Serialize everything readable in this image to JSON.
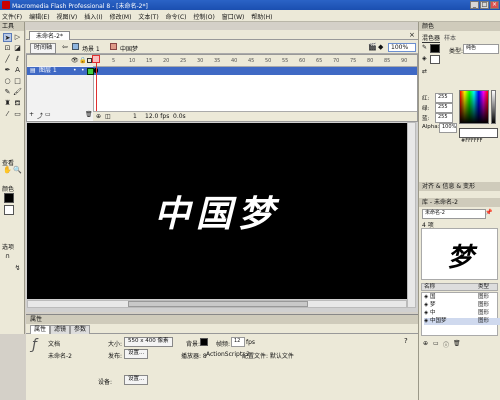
{
  "window": {
    "title": "Macromedia Flash Professional 8 - [未命名-2*]"
  },
  "menu": [
    "文件(F)",
    "编辑(E)",
    "视图(V)",
    "插入(I)",
    "修改(M)",
    "文本(T)",
    "命令(C)",
    "控制(O)",
    "窗口(W)",
    "帮助(H)"
  ],
  "toolbox": {
    "header": "工具",
    "sections": [
      "查看",
      "颜色",
      "选项"
    ]
  },
  "document": {
    "tab": "未命名-2*",
    "timeline_button": "时间轴",
    "scene_label": "场景 1",
    "symbol_label": "中国梦",
    "zoom": "100%"
  },
  "timeline": {
    "layer_name": "图层 1",
    "frame_numbers": [
      "1",
      "5",
      "10",
      "15",
      "20",
      "25",
      "30",
      "35",
      "40",
      "45",
      "50",
      "55",
      "60",
      "65",
      "70",
      "75",
      "80",
      "85",
      "90"
    ],
    "current_frame": "1",
    "fps": "12.0 fps",
    "time": "0.0s"
  },
  "stage": {
    "text": "中国梦"
  },
  "properties": {
    "panel_title": "属性",
    "tabs": [
      "属性",
      "滤镜",
      "参数"
    ],
    "doc_type": "文档",
    "doc_name": "未命名-2",
    "size_label": "大小:",
    "size_value": "550 x 400 像素",
    "bg_label": "背景:",
    "fps_label": "帧频:",
    "fps_value": "12",
    "fps_unit": "fps",
    "publish_label": "发布:",
    "settings_button": "设置...",
    "player_label": "播放器: 8",
    "as_label": "ActionScript: 2",
    "profile_label": "配置文件: 默认文件",
    "device_label": "设备:",
    "device_button": "设置..."
  },
  "color_panel": {
    "title": "颜色",
    "tabs": [
      "混色器",
      "样本"
    ],
    "type_label": "类型:",
    "type_value": "纯色",
    "r": "255",
    "g": "255",
    "b": "255",
    "alpha_label": "Alpha:",
    "alpha_value": "100%",
    "hex": "#FFFFFF",
    "colors": {
      "fill": "#FFFFFF",
      "stroke": "#000000"
    }
  },
  "align_panel": {
    "title": "对齐 & 信息 & 变形"
  },
  "library": {
    "title": "库 - 未命名-2",
    "doc_select": "未命名-2",
    "count": "4 项",
    "preview_char": "梦",
    "header_name": "名称",
    "header_type": "类型",
    "items": [
      {
        "name": "国",
        "type": "图形"
      },
      {
        "name": "梦",
        "type": "图形"
      },
      {
        "name": "中",
        "type": "图形"
      },
      {
        "name": "中国梦",
        "type": "图形"
      }
    ]
  }
}
